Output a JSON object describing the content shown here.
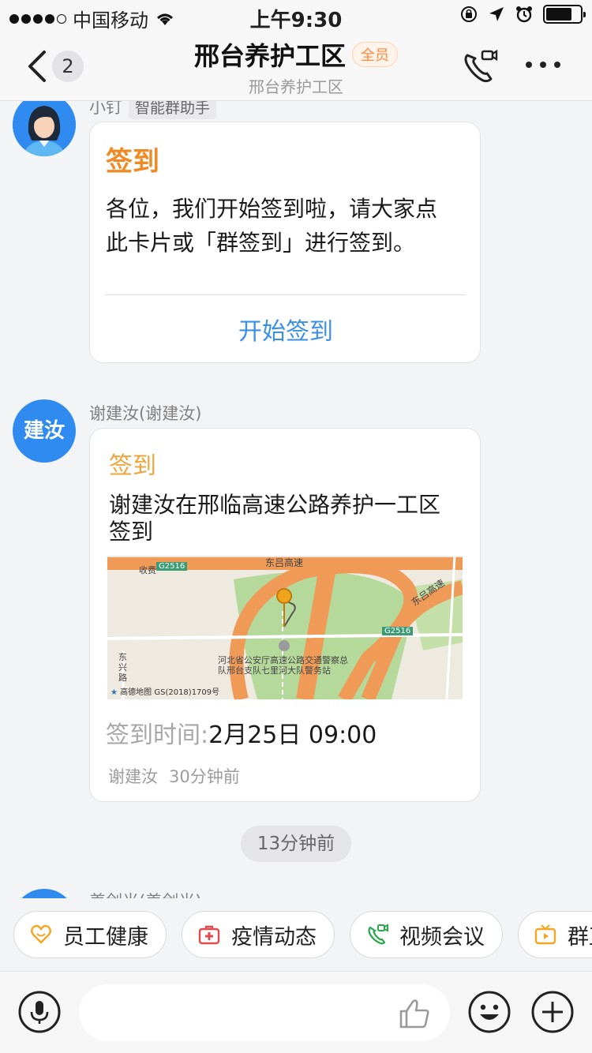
{
  "status_bar": {
    "carrier": "中国移动",
    "time": "上午9:30"
  },
  "nav": {
    "unread_count": "2",
    "title": "邢台养护工区",
    "tag": "全员",
    "subtitle": "邢台养护工区"
  },
  "messages": [
    {
      "sender": "小钉",
      "sender_tag": "智能群助手",
      "card_title": "签到",
      "card_text": "各位，我们开始签到啦，请大家点此卡片或「群签到」进行签到。",
      "action": "开始签到"
    },
    {
      "avatar_text": "建汝",
      "sender": "谢建汝(谢建汝)",
      "card_title": "签到",
      "card_text": "谢建汝在邢临高速公路养护一工区签到",
      "map_labels": {
        "road_top": "东吕高速",
        "road_right": "东吕高速",
        "g_top": "G2516",
        "g_right": "G2516",
        "toll": "收费",
        "street": "东兴路",
        "poi": "河北省公安厅高速公路交通警察总队邢台支队七里河大队警务站",
        "logo": "高德地图",
        "license": "GS(2018)1709号"
      },
      "time_label": "签到时间:",
      "time_value": "2月25日 09:00",
      "footer_name": "谢建汝",
      "footer_ago": "30分钟前"
    }
  ],
  "separator": "13分钟前",
  "next_sender": "姜剑光(姜剑光)",
  "quick_actions": [
    {
      "label": "员工健康",
      "icon": "heart-icon"
    },
    {
      "label": "疫情动态",
      "icon": "medkit-icon"
    },
    {
      "label": "视频会议",
      "icon": "video-call-icon"
    },
    {
      "label": "群直播",
      "icon": "tv-icon"
    }
  ],
  "input": {
    "placeholder": ""
  },
  "colors": {
    "accent_orange": "#f08a24",
    "link_blue": "#3a8fe6",
    "avatar_blue": "#2f8bf0"
  }
}
